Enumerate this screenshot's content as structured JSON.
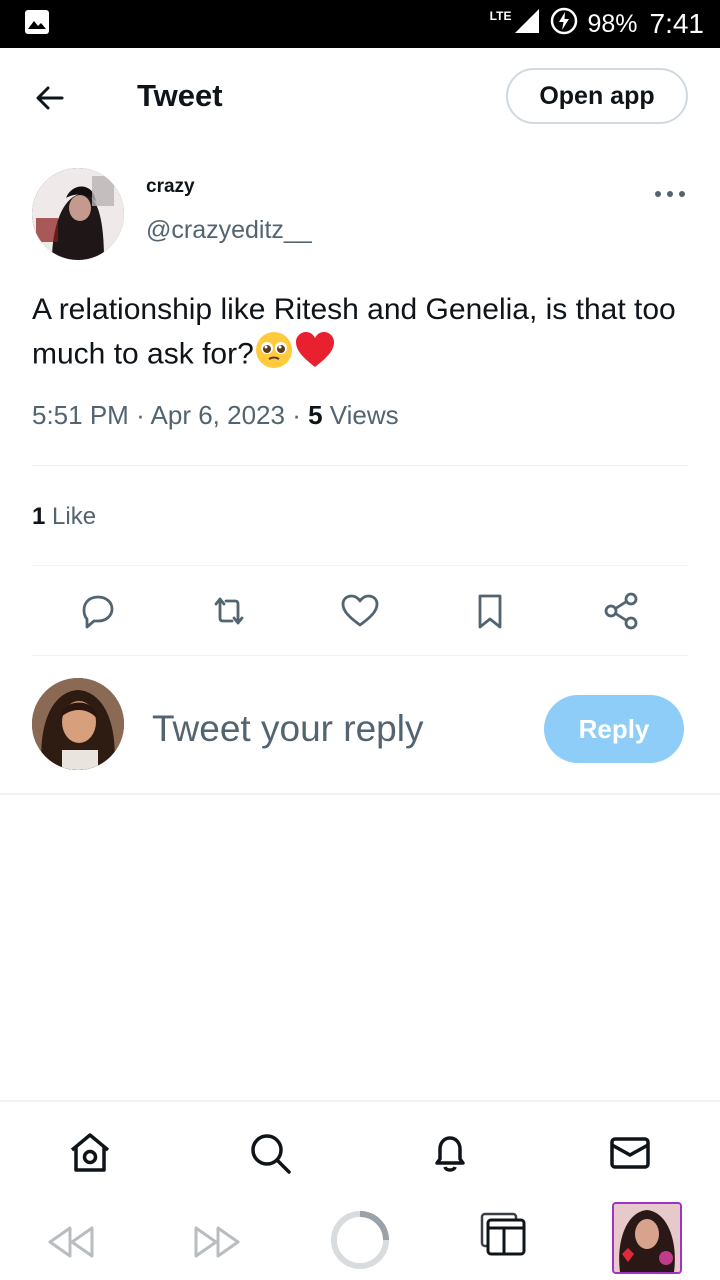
{
  "status_bar": {
    "network": "LTE",
    "battery": "98%",
    "time": "7:41"
  },
  "header": {
    "title": "Tweet",
    "open_app_label": "Open app"
  },
  "tweet": {
    "author_name": "crazy",
    "author_handle": "@crazyeditz__",
    "text": "A relationship like Ritesh and Genelia, is that too much to ask for?",
    "emojis": [
      "pleading-face",
      "red-heart"
    ],
    "time": "5:51 PM",
    "date": "Apr 6, 2023",
    "views_count": "5",
    "views_label": "Views",
    "likes_count": "1",
    "likes_label": "Like"
  },
  "reply_box": {
    "placeholder": "Tweet your reply",
    "button_label": "Reply"
  },
  "bottom_nav": {
    "items": [
      "home-icon",
      "search-icon",
      "notifications-icon",
      "messages-icon"
    ]
  },
  "browser_bar": {
    "items": [
      "back-icon",
      "forward-icon",
      "reload-icon",
      "tabs-icon",
      "profile-thumbnail"
    ]
  },
  "colors": {
    "text": "#0f1419",
    "secondary": "#536471",
    "reply_button": "#8ecdf8",
    "divider": "#eff3f4"
  }
}
